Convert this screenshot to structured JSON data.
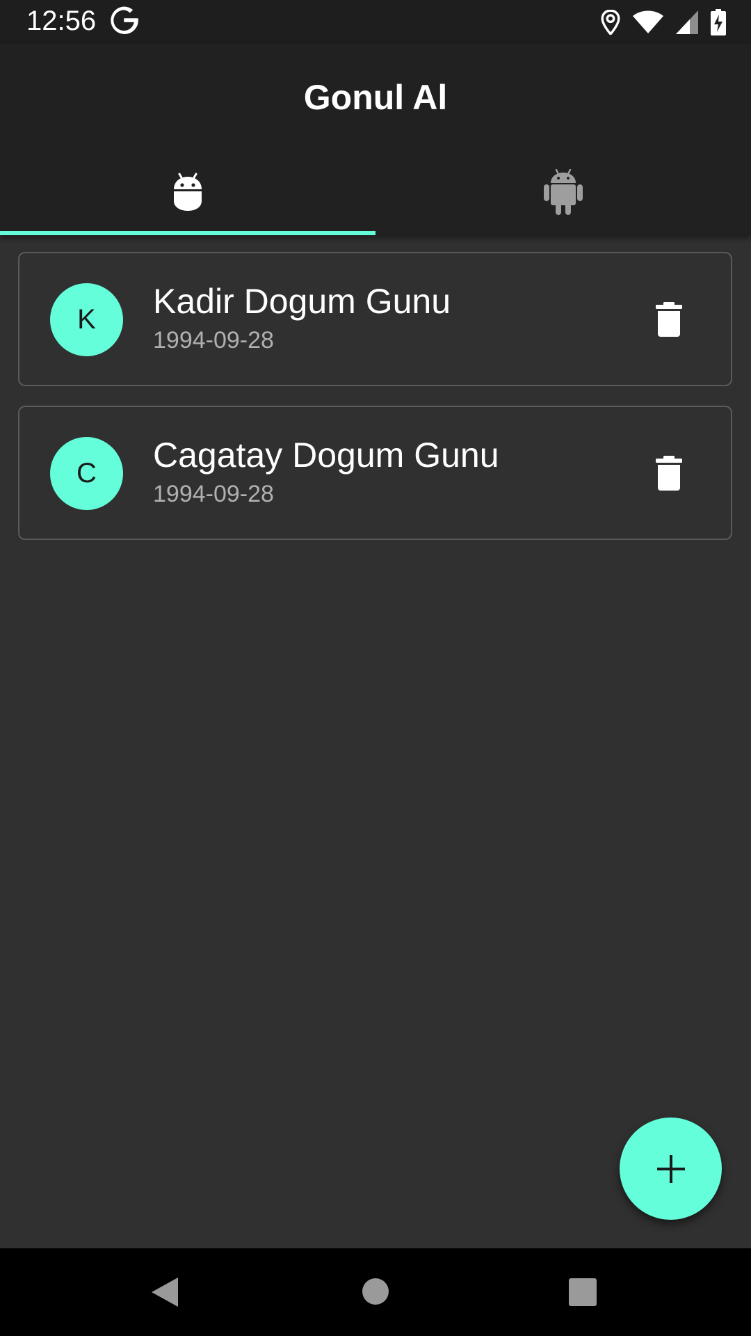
{
  "status_bar": {
    "time": "12:56",
    "icons": [
      "google-g-icon",
      "location-icon",
      "wifi-icon",
      "signal-icon",
      "battery-charging-icon"
    ]
  },
  "app_bar": {
    "title": "Gonul Al"
  },
  "tabs": [
    {
      "icon": "android-head-icon",
      "selected": true
    },
    {
      "icon": "android-robot-icon",
      "selected": false
    }
  ],
  "birthdays": [
    {
      "initial": "K",
      "title": "Kadir Dogum Gunu",
      "date": "1994-09-28"
    },
    {
      "initial": "C",
      "title": "Cagatay Dogum Gunu",
      "date": "1994-09-28"
    }
  ],
  "fab": {
    "icon": "plus-icon"
  },
  "nav_bar": {
    "icons": [
      "back-icon",
      "home-icon",
      "recents-icon"
    ]
  },
  "colors": {
    "accent": "#64ffda",
    "background": "#303030",
    "app_bar": "#212121",
    "status_bar": "#1e1e1e"
  }
}
